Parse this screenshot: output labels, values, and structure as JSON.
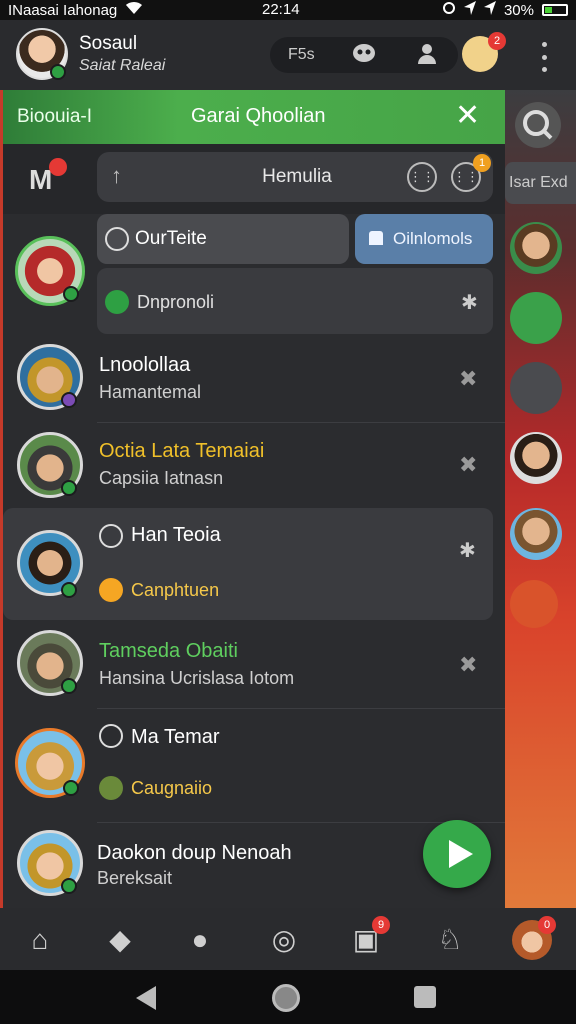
{
  "status_bar": {
    "carrier": "INaasai Iahonag",
    "time": "22:14",
    "battery": "30%"
  },
  "header": {
    "name": "Sosaul",
    "subtitle": "Saiat Raleai",
    "segment_label": "F5s",
    "profile_badge": "2"
  },
  "banner": {
    "left_text": "Bioouia-I",
    "center_text": "Garai Qhoolian"
  },
  "search": {
    "value": "Hemulia",
    "badge": "1"
  },
  "top_card": {
    "title": "OurTeite",
    "chip_label": "Oilnlomols",
    "status": "Dnpronoli"
  },
  "contacts": [
    {
      "title": "Lnoolollaa",
      "subtitle": "Hamantemal",
      "title_color": "#ffffff"
    },
    {
      "title": "Octia Lata Temaiai",
      "subtitle": "Capsiia Iatnasn",
      "title_color": "#f0c02a"
    },
    {
      "title": "Han Teoia",
      "subtitle": "Canphtuen",
      "title_color": "#ffffff",
      "subtitle_color": "#f5c84a"
    },
    {
      "title": "Tamseda Obaiti",
      "subtitle": "Hansina Ucrislasa Iotom",
      "title_color": "#5fcf5f"
    },
    {
      "title": "Ma Temar",
      "subtitle": "Caugnaiio",
      "title_color": "#ffffff",
      "subtitle_color": "#f5c84a"
    },
    {
      "title": "Daokon doup Nenoah",
      "subtitle": "Bereksait",
      "title_color": "#ffffff"
    }
  ],
  "side_panel": {
    "label": "Isar Exd"
  },
  "tabbar": {
    "badge_media": "9",
    "badge_profile": "0"
  },
  "colors": {
    "accent_green": "#35a94a",
    "chip_blue": "#5a7fa8",
    "badge_red": "#e53935"
  }
}
